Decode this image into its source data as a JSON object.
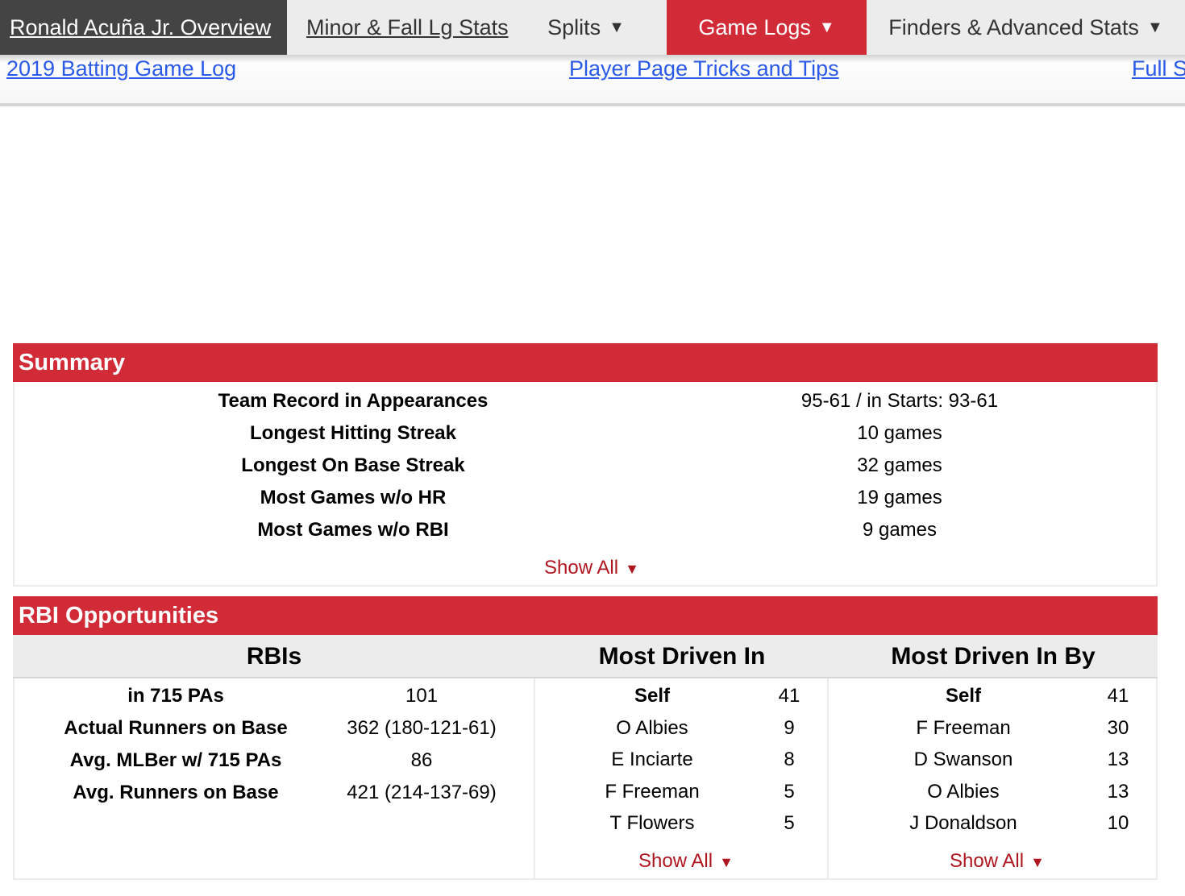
{
  "nav": {
    "overview": "Ronald Acuña Jr. Overview",
    "minor": "Minor & Fall Lg Stats",
    "splits": "Splits",
    "game_logs": "Game Logs",
    "finders": "Finders & Advanced Stats",
    "caret": "▼"
  },
  "subnav": {
    "link1": "2019 Batting Game Log",
    "link2": "Player Page Tricks and Tips",
    "link3": "Full S"
  },
  "summary": {
    "title": "Summary",
    "rows": [
      {
        "label": "Team Record in Appearances",
        "value": "95-61 / in Starts: 93-61"
      },
      {
        "label": "Longest Hitting Streak",
        "value": "10 games"
      },
      {
        "label": "Longest On Base Streak",
        "value": "32 games"
      },
      {
        "label": "Most Games w/o HR",
        "value": "19 games"
      },
      {
        "label": "Most Games w/o RBI",
        "value": "9 games"
      }
    ],
    "show_all": "Show All",
    "tri": "▼"
  },
  "rbi": {
    "title": "RBI Opportunities",
    "col1": "RBIs",
    "col2": "Most Driven In",
    "col3": "Most Driven In By",
    "rbis": [
      {
        "label": "in 715 PAs",
        "value": "101"
      },
      {
        "label": "Actual Runners on Base",
        "value": "362 (180-121-61)"
      },
      {
        "label": "Avg. MLBer w/ 715 PAs",
        "value": "86"
      },
      {
        "label": "Avg. Runners on Base",
        "value": "421 (214-137-69)"
      }
    ],
    "driven_in": [
      {
        "name": "Self",
        "count": "41"
      },
      {
        "name": "O Albies",
        "count": "9"
      },
      {
        "name": "E Inciarte",
        "count": "8"
      },
      {
        "name": "F Freeman",
        "count": "5"
      },
      {
        "name": "T Flowers",
        "count": "5"
      }
    ],
    "driven_in_by": [
      {
        "name": "Self",
        "count": "41"
      },
      {
        "name": "F Freeman",
        "count": "30"
      },
      {
        "name": "D Swanson",
        "count": "13"
      },
      {
        "name": "O Albies",
        "count": "13"
      },
      {
        "name": "J Donaldson",
        "count": "10"
      }
    ],
    "show_all": "Show All",
    "tri": "▼"
  }
}
